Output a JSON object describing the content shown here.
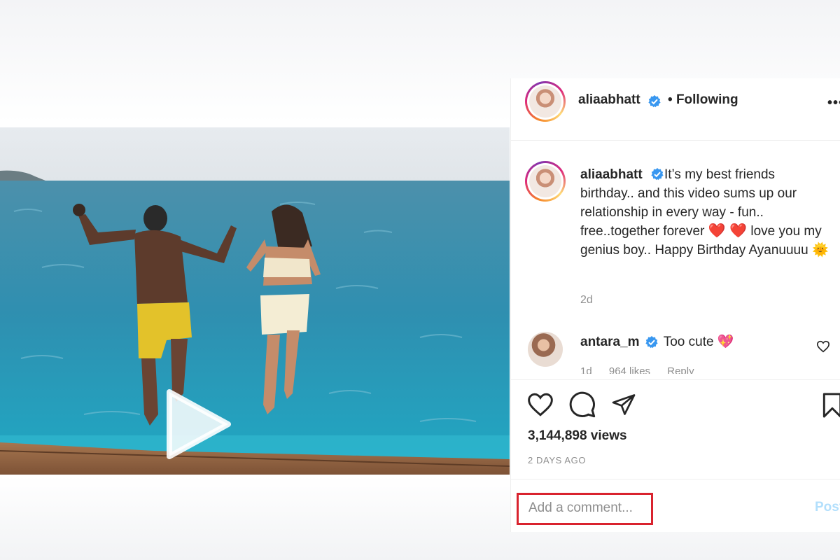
{
  "post": {
    "username": "aliaabhatt",
    "separator": "•",
    "follow_status": "Following",
    "more_label": "•••"
  },
  "caption": {
    "username": "aliaabhatt",
    "text_1": "It’s my best friends birthday.. and this video sums up our relationship in every way - fun.. free..together forever",
    "emoji_hearts": "❤️ ❤️",
    "text_2": "love you my genius boy.. Happy Birthday Ayanuuuu",
    "emoji_sun": "🌞",
    "age": "2d"
  },
  "comments": [
    {
      "username": "antara_m",
      "text": "Too cute",
      "emoji": "💖",
      "age": "1d",
      "likes": "964 likes",
      "reply": "Reply"
    }
  ],
  "stats": {
    "views": "3,144,898 views",
    "date": "2 DAYS AGO"
  },
  "composer": {
    "placeholder": "Add a comment...",
    "post_label": "Post"
  },
  "icons": {
    "verified": "verified-badge-icon",
    "play": "play-icon",
    "like": "heart-icon",
    "comment": "comment-icon",
    "share": "paper-plane-icon",
    "save": "bookmark-icon"
  },
  "colors": {
    "verified_blue": "#3897f0",
    "highlight_red": "#d9232e",
    "post_blue_disabled": "#b2dffc"
  }
}
